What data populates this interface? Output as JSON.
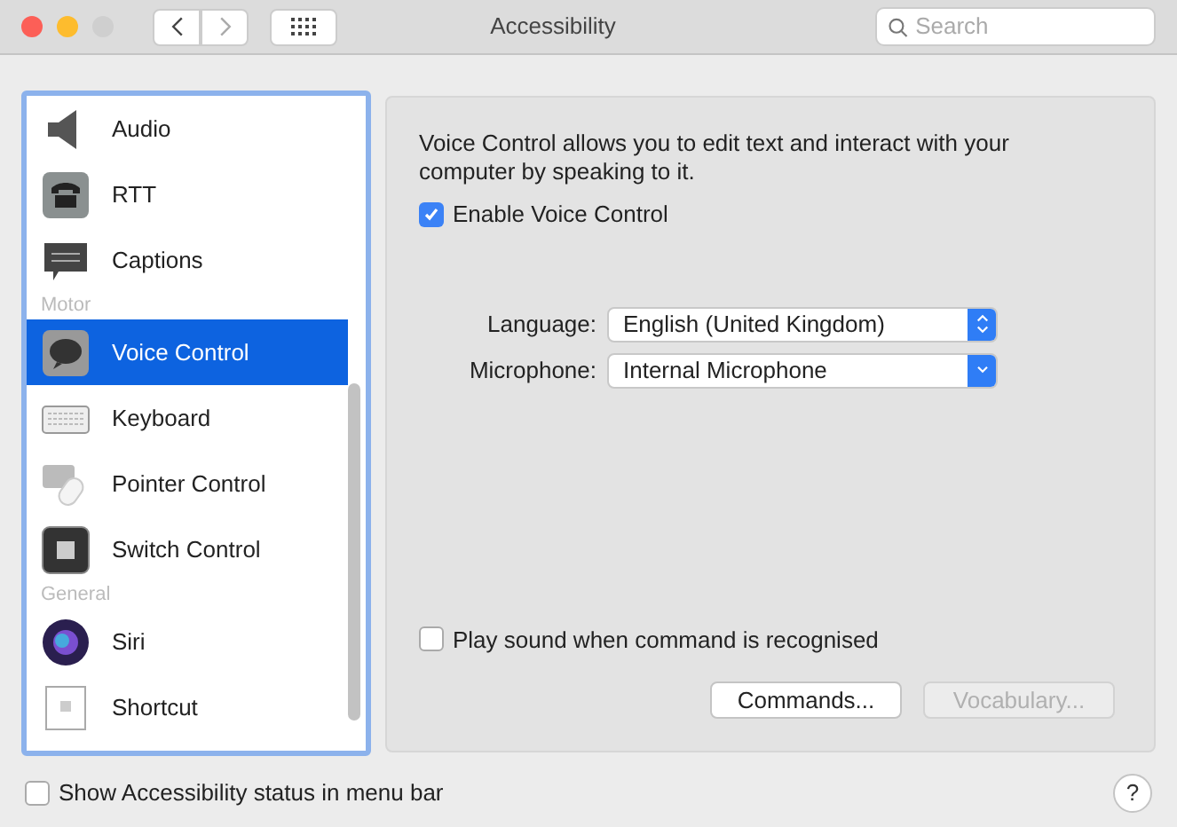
{
  "window": {
    "title": "Accessibility"
  },
  "search": {
    "placeholder": "Search"
  },
  "sidebar": {
    "items": [
      {
        "kind": "item",
        "label": "Audio",
        "selected": false
      },
      {
        "kind": "item",
        "label": "RTT",
        "selected": false
      },
      {
        "kind": "item",
        "label": "Captions",
        "selected": false
      },
      {
        "kind": "header",
        "label": "Motor"
      },
      {
        "kind": "item",
        "label": "Voice Control",
        "selected": true
      },
      {
        "kind": "item",
        "label": "Keyboard",
        "selected": false
      },
      {
        "kind": "item",
        "label": "Pointer Control",
        "selected": false
      },
      {
        "kind": "item",
        "label": "Switch Control",
        "selected": false
      },
      {
        "kind": "header",
        "label": "General"
      },
      {
        "kind": "item",
        "label": "Siri",
        "selected": false
      },
      {
        "kind": "item",
        "label": "Shortcut",
        "selected": false
      }
    ]
  },
  "panel": {
    "description": "Voice Control allows you to edit text and interact with your computer by speaking to it.",
    "enable": {
      "label": "Enable Voice Control",
      "checked": true
    },
    "fields": [
      {
        "label": "Language:",
        "value": "English (United Kingdom)",
        "kind": "popup"
      },
      {
        "label": "Microphone:",
        "value": "Internal Microphone",
        "kind": "pulldown"
      }
    ],
    "play_sound": {
      "label": "Play sound when command is recognised",
      "checked": false
    },
    "buttons": [
      {
        "label": "Commands...",
        "disabled": false
      },
      {
        "label": "Vocabulary...",
        "disabled": true
      }
    ]
  },
  "status_checkbox": {
    "label": "Show Accessibility status in menu bar",
    "checked": false
  },
  "help": {
    "label": "?"
  }
}
